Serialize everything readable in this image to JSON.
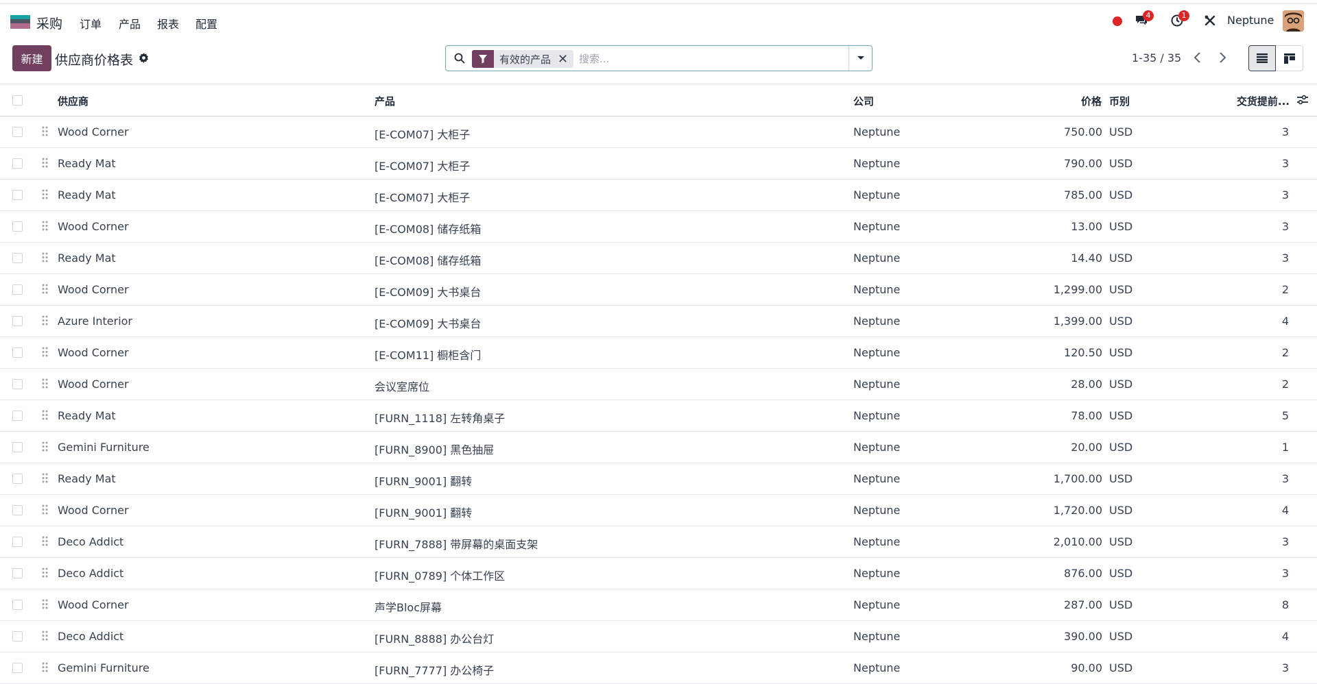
{
  "app": {
    "name": "采购"
  },
  "menu": [
    "订单",
    "产品",
    "报表",
    "配置"
  ],
  "systray": {
    "messages_count": "4",
    "activities_count": "1",
    "company": "Neptune"
  },
  "control": {
    "new_label": "新建",
    "title": "供应商价格表",
    "search": {
      "facet_label": "有效的产品",
      "placeholder": "搜索..."
    },
    "pager": "1-35 / 35"
  },
  "table": {
    "headers": {
      "vendor": "供应商",
      "product": "产品",
      "company": "公司",
      "price": "价格",
      "currency": "币别",
      "lead_time": "交货提前..."
    },
    "rows": [
      {
        "vendor": "Wood Corner",
        "product": "[E-COM07] 大柜子",
        "company": "Neptune",
        "price": "750.00",
        "currency": "USD",
        "lead_time": "3"
      },
      {
        "vendor": "Ready Mat",
        "product": "[E-COM07] 大柜子",
        "company": "Neptune",
        "price": "790.00",
        "currency": "USD",
        "lead_time": "3"
      },
      {
        "vendor": "Ready Mat",
        "product": "[E-COM07] 大柜子",
        "company": "Neptune",
        "price": "785.00",
        "currency": "USD",
        "lead_time": "3"
      },
      {
        "vendor": "Wood Corner",
        "product": "[E-COM08] 储存纸箱",
        "company": "Neptune",
        "price": "13.00",
        "currency": "USD",
        "lead_time": "3"
      },
      {
        "vendor": "Ready Mat",
        "product": "[E-COM08] 储存纸箱",
        "company": "Neptune",
        "price": "14.40",
        "currency": "USD",
        "lead_time": "3"
      },
      {
        "vendor": "Wood Corner",
        "product": "[E-COM09] 大书桌台",
        "company": "Neptune",
        "price": "1,299.00",
        "currency": "USD",
        "lead_time": "2"
      },
      {
        "vendor": "Azure Interior",
        "product": "[E-COM09] 大书桌台",
        "company": "Neptune",
        "price": "1,399.00",
        "currency": "USD",
        "lead_time": "4"
      },
      {
        "vendor": "Wood Corner",
        "product": "[E-COM11] 橱柜含门",
        "company": "Neptune",
        "price": "120.50",
        "currency": "USD",
        "lead_time": "2"
      },
      {
        "vendor": "Wood Corner",
        "product": "会议室席位",
        "company": "Neptune",
        "price": "28.00",
        "currency": "USD",
        "lead_time": "2"
      },
      {
        "vendor": "Ready Mat",
        "product": "[FURN_1118] 左转角桌子",
        "company": "Neptune",
        "price": "78.00",
        "currency": "USD",
        "lead_time": "5"
      },
      {
        "vendor": "Gemini Furniture",
        "product": "[FURN_8900] 黑色抽屉",
        "company": "Neptune",
        "price": "20.00",
        "currency": "USD",
        "lead_time": "1"
      },
      {
        "vendor": "Ready Mat",
        "product": "[FURN_9001] 翻转",
        "company": "Neptune",
        "price": "1,700.00",
        "currency": "USD",
        "lead_time": "3"
      },
      {
        "vendor": "Wood Corner",
        "product": "[FURN_9001] 翻转",
        "company": "Neptune",
        "price": "1,720.00",
        "currency": "USD",
        "lead_time": "4"
      },
      {
        "vendor": "Deco Addict",
        "product": "[FURN_7888] 带屏幕的桌面支架",
        "company": "Neptune",
        "price": "2,010.00",
        "currency": "USD",
        "lead_time": "3"
      },
      {
        "vendor": "Deco Addict",
        "product": "[FURN_0789] 个体工作区",
        "company": "Neptune",
        "price": "876.00",
        "currency": "USD",
        "lead_time": "3"
      },
      {
        "vendor": "Wood Corner",
        "product": "声学Bloc屏幕",
        "company": "Neptune",
        "price": "287.00",
        "currency": "USD",
        "lead_time": "8"
      },
      {
        "vendor": "Deco Addict",
        "product": "[FURN_8888] 办公台灯",
        "company": "Neptune",
        "price": "390.00",
        "currency": "USD",
        "lead_time": "4"
      },
      {
        "vendor": "Gemini Furniture",
        "product": "[FURN_7777] 办公椅子",
        "company": "Neptune",
        "price": "90.00",
        "currency": "USD",
        "lead_time": "3"
      }
    ]
  },
  "colors": {
    "primary": "#71405e",
    "badge": "#dc2626",
    "search_border": "#71a8b0"
  },
  "icons": [
    "search-icon",
    "filter-icon",
    "gear-icon",
    "chat-icon",
    "clock-icon",
    "tools-icon",
    "list-view-icon",
    "kanban-view-icon",
    "drag-handle-icon",
    "settings-sliders-icon"
  ]
}
